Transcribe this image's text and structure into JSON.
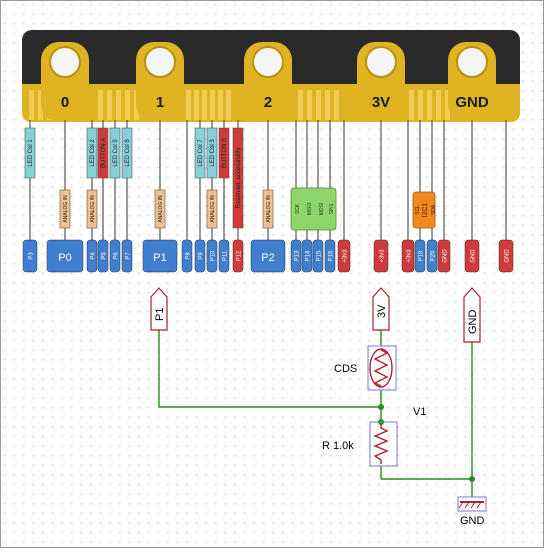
{
  "board": {
    "edge_pads": [
      "0",
      "1",
      "2",
      "3V",
      "GND"
    ],
    "pin_labels": [
      "P3",
      "P0",
      "P4",
      "P5",
      "P6",
      "P7",
      "P1",
      "P8",
      "P9",
      "P10",
      "P11",
      "P12",
      "P2",
      "P13",
      "P14",
      "P15",
      "P16",
      "+3v3",
      "+3v3",
      "P19",
      "P20",
      "GND",
      "GND",
      "GND"
    ],
    "led_labels": [
      "LED Col 1",
      "LED Col 2",
      "LED Col 9",
      "LED Col 8",
      "LED Col 7",
      "LED Col 3"
    ],
    "analog_labels": [
      "ANALOG IN",
      "ANALOG IN",
      "ANALOG IN",
      "ANALOG IN",
      "ANALOG IN"
    ],
    "button_labels": [
      "BUTTON A",
      "BUTTON B"
    ],
    "reserved_label": "Reserved: accessibility",
    "spi_labels": [
      "SCK",
      "MISO",
      "MOSI",
      "SPI1"
    ],
    "i2c_labels": [
      "SCL",
      "I2C1",
      "SDA"
    ]
  },
  "schematic": {
    "port_p1": "P1",
    "port_3v": "3V",
    "port_gnd": "GND",
    "cds_label": "CDS",
    "node_label": "V1",
    "resistor_label": "R 1.0k",
    "gnd_symbol_label": "GND"
  },
  "colors": {
    "board": "#2a2a2a",
    "gold": "#e0b323",
    "pin_blue": "#3f7fd0",
    "pin_red": "#d03a3a",
    "led_cyan": "#88cfdc",
    "analog_tan": "#f0c08e",
    "spi_green": "#8fd66a",
    "i2c_orange": "#f08a1e",
    "wire_green": "#1f8f1f",
    "component_red": "#a8232b",
    "component_box": "#7a7ac8"
  }
}
